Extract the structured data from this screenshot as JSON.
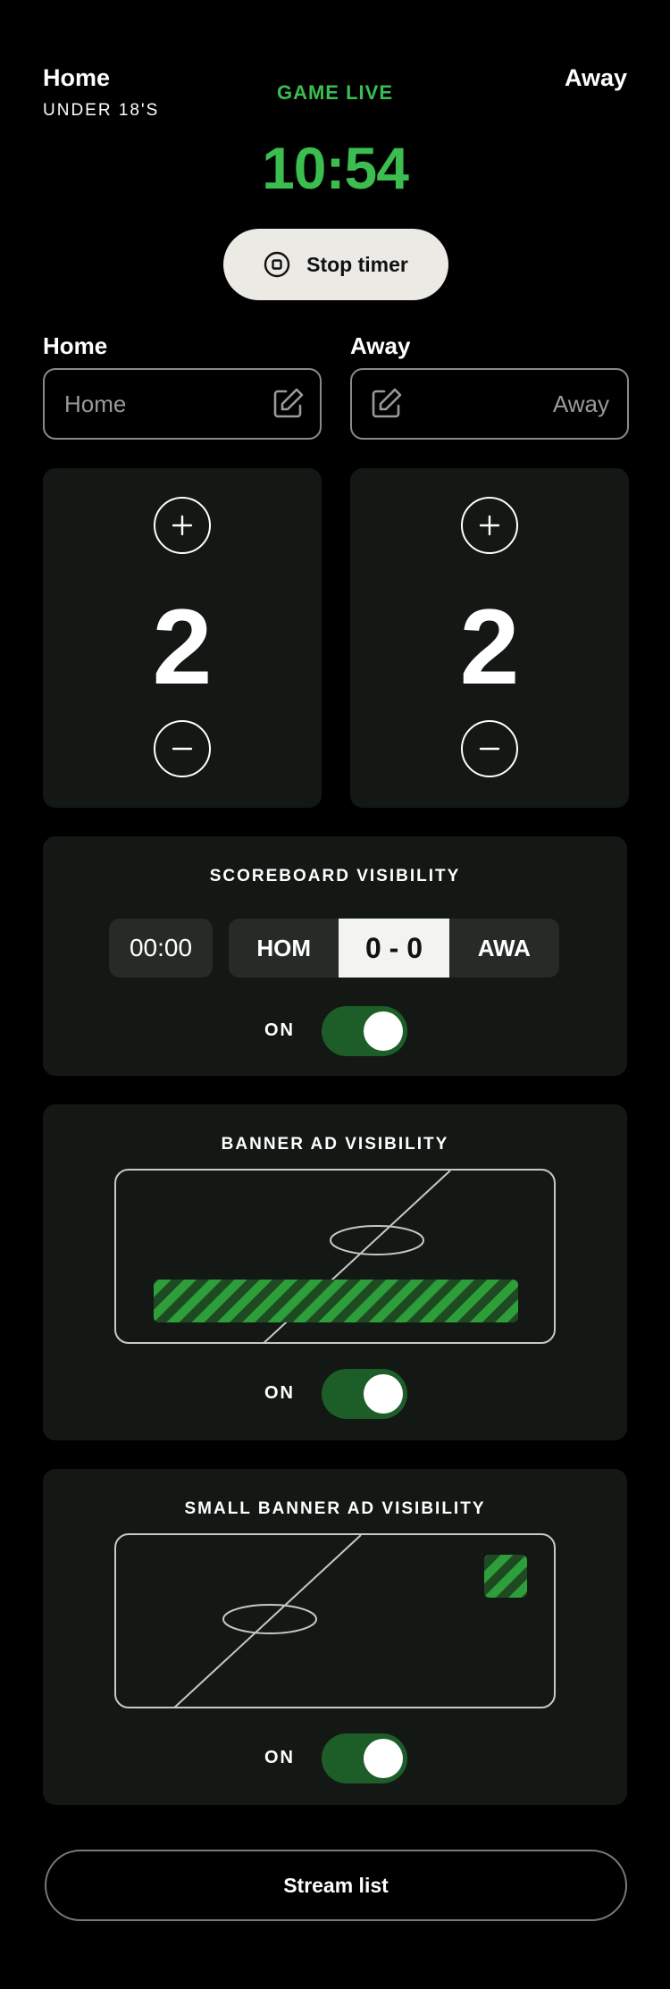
{
  "header": {
    "home_title": "Home",
    "age_group": "UNDER 18'S",
    "away_title": "Away",
    "status": "GAME LIVE",
    "timer": "10:54",
    "stop_timer_label": "Stop timer"
  },
  "teams": {
    "home": {
      "label": "Home",
      "placeholder": "Home"
    },
    "away": {
      "label": "Away",
      "placeholder": "Away"
    }
  },
  "scores": {
    "home": "2",
    "away": "2"
  },
  "scoreboard": {
    "title": "SCOREBOARD VISIBILITY",
    "time": "00:00",
    "home_abbr": "HOM",
    "score": "0 - 0",
    "away_abbr": "AWA",
    "toggle_label": "ON",
    "toggle_on": true
  },
  "banner_ad": {
    "title": "BANNER AD VISIBILITY",
    "toggle_label": "ON",
    "toggle_on": true
  },
  "small_banner_ad": {
    "title": "SMALL BANNER AD VISIBILITY",
    "toggle_label": "ON",
    "toggle_on": true
  },
  "stream_list_label": "Stream list",
  "colors": {
    "accent_green": "#3cbd4f",
    "toggle_green": "#1d5e28",
    "panel": "#141814",
    "stripe_green": "#2e9e3b"
  },
  "icons": [
    "stop-icon",
    "edit-icon",
    "plus-icon",
    "minus-icon"
  ]
}
